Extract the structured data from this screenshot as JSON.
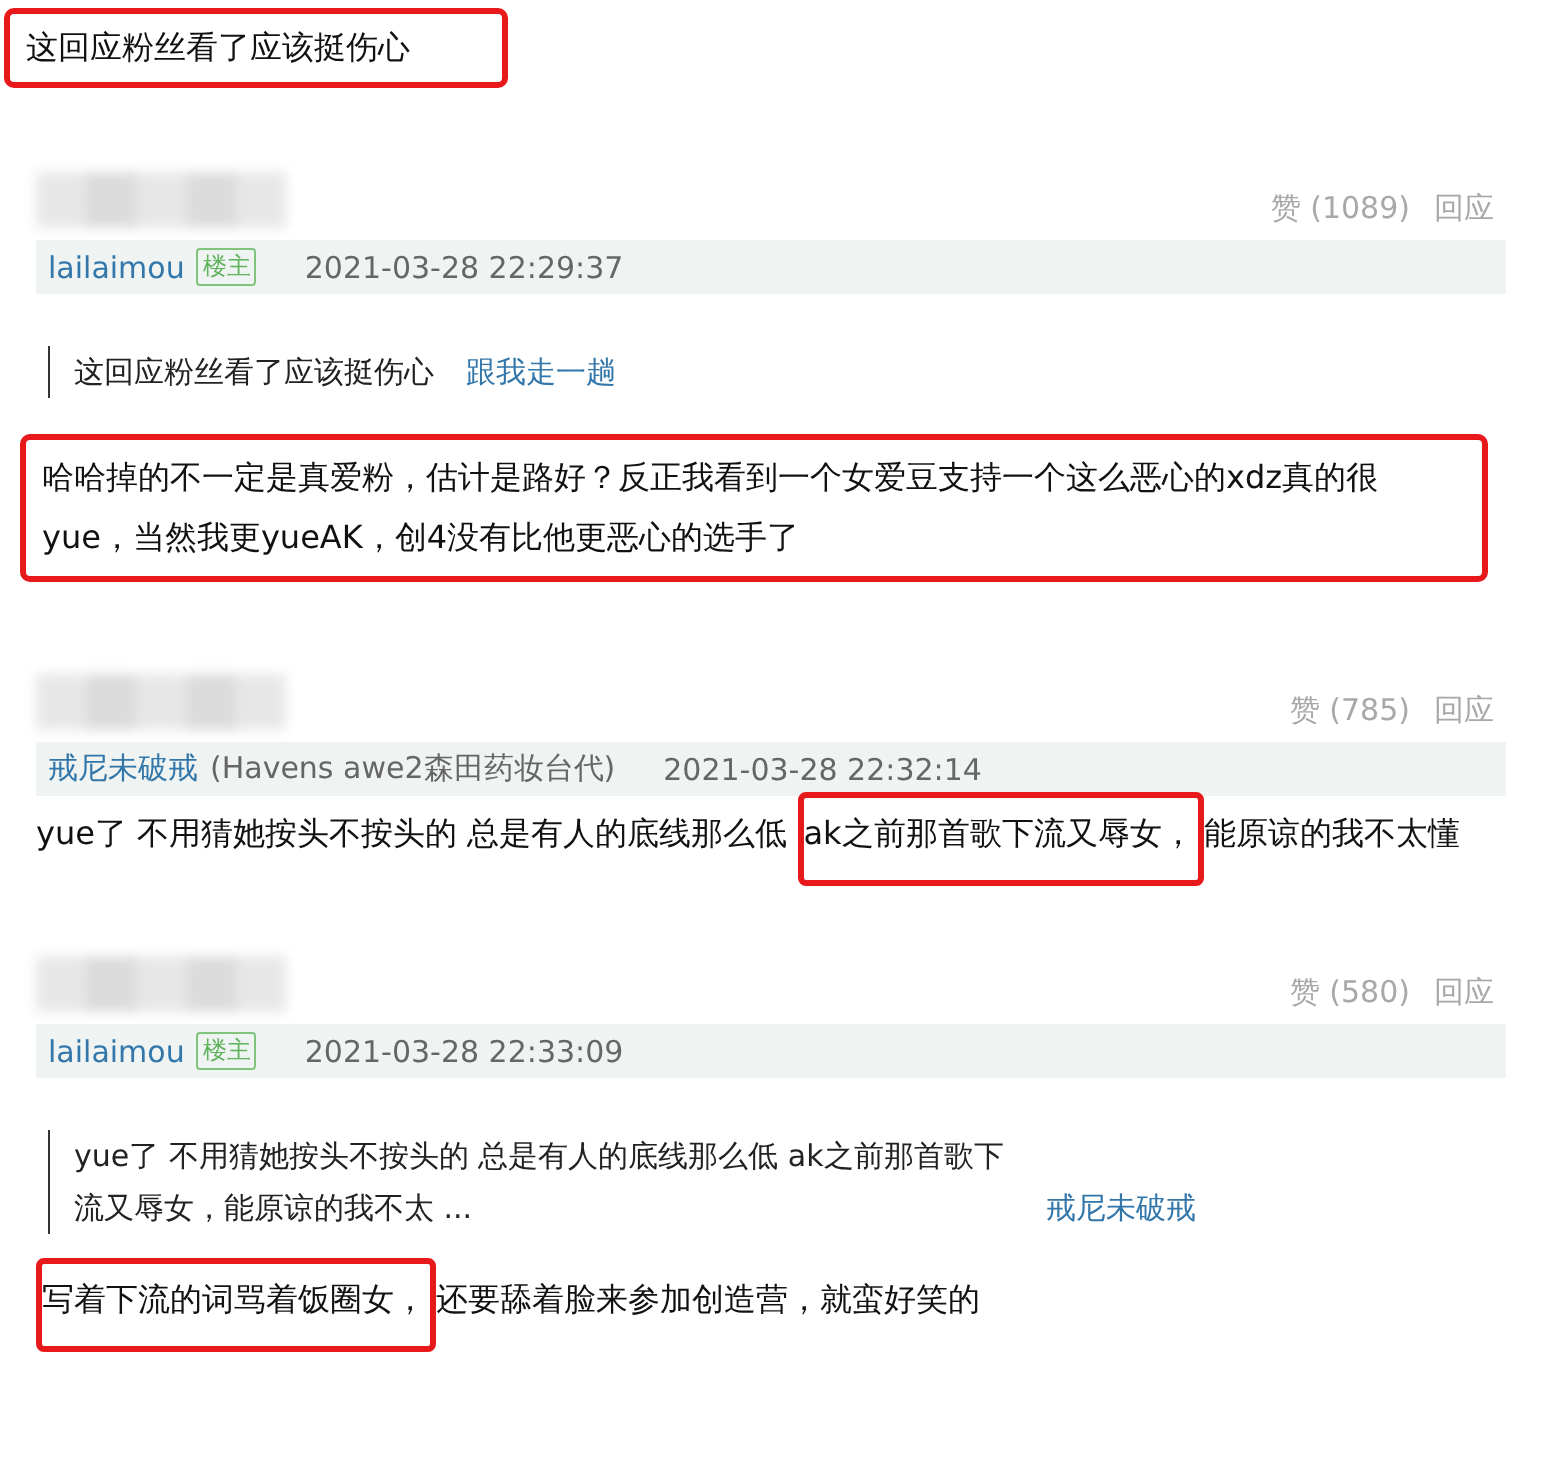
{
  "top_text": {
    "boxed": true,
    "segments": [
      {
        "text": "这回应粉丝看了应该挺伤心",
        "annotated": false
      }
    ]
  },
  "comments": [
    {
      "votes": "赞 (1089)",
      "reply": "回应",
      "author": "lailaimou",
      "badge": "楼主",
      "time": "2021-03-28 22:29:37",
      "quote": {
        "text": "这回应粉丝看了应该挺伤心",
        "author": "跟我走一趟"
      },
      "boxed": true,
      "segments": [
        {
          "text": "哈哈掉的不一定是真爱粉，估计是路好？反正我看到一个女爱豆支持一个这么恶心的xdz真的很yue，当然我更yueAK，创4没有比他更恶心的选手了",
          "annotated": false
        }
      ]
    },
    {
      "votes": "赞 (785)",
      "reply": "回应",
      "author": "戒尼未破戒",
      "author_note": "(Havens awe2森田药妆台代)",
      "time": "2021-03-28 22:32:14",
      "boxed": false,
      "segments": [
        {
          "text": "yue了 不用猜她按头不按头的 总是有人的底线那么低 ",
          "annotated": false
        },
        {
          "text": "ak之前那首歌下流又辱女，",
          "annotated": true
        },
        {
          "text": "能原谅的我不太懂",
          "annotated": false
        }
      ]
    },
    {
      "votes": "赞 (580)",
      "reply": "回应",
      "author": "lailaimou",
      "badge": "楼主",
      "time": "2021-03-28 22:33:09",
      "quote": {
        "text": "yue了 不用猜她按头不按头的 总是有人的底线那么低 ak之前那首歌下流又辱女，能原谅的我不太 ...",
        "author": "戒尼未破戒"
      },
      "boxed": false,
      "segments": [
        {
          "text": "写着下流的词骂着饭圈女，",
          "annotated": true
        },
        {
          "text": "还要舔着脸来参加创造营，就蛮好笑的",
          "annotated": false
        }
      ]
    }
  ]
}
